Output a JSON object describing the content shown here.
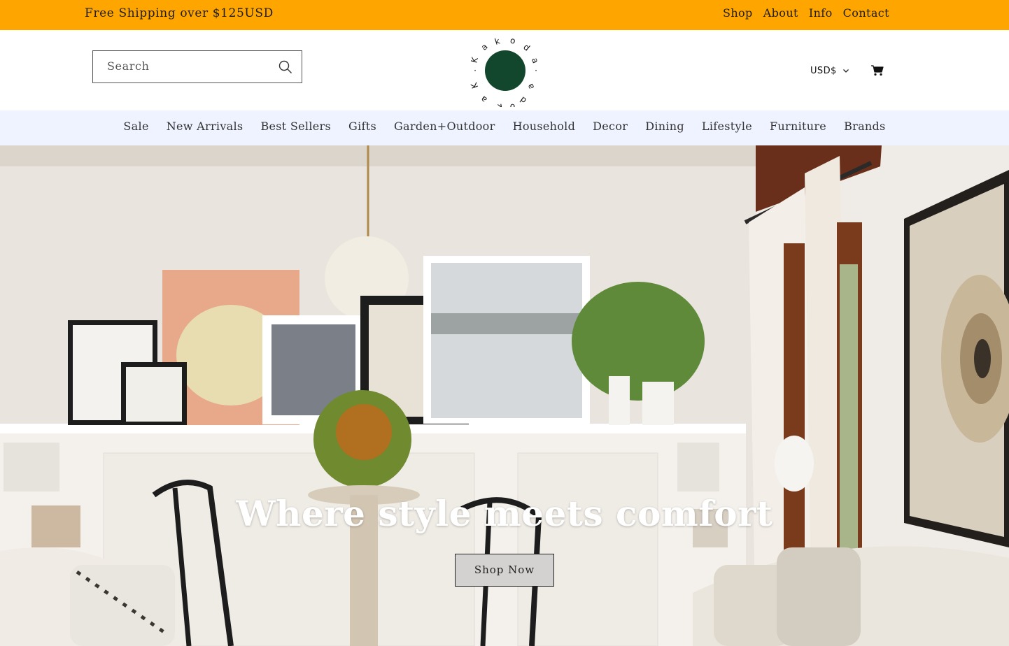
{
  "announcement": {
    "shipping_text": "Free Shipping over $125USD",
    "links": [
      "Shop",
      "About",
      "Info",
      "Contact"
    ]
  },
  "header": {
    "search_placeholder": "Search",
    "logo_text": "Kakoda",
    "currency": "USD$",
    "icons": [
      "search-icon",
      "cart-icon",
      "chevron-down-icon"
    ]
  },
  "nav": {
    "items": [
      "Sale",
      "New Arrivals",
      "Best Sellers",
      "Gifts",
      "Garden+Outdoor",
      "Household",
      "Decor",
      "Dining",
      "Lifestyle",
      "Furniture",
      "Brands"
    ]
  },
  "hero": {
    "headline": "Where style meets comfort",
    "button_label": "Shop Now"
  },
  "colors": {
    "announcement_bg": "#ffa500",
    "nav_bg": "#eef3ff",
    "logo_circle": "#12472e"
  }
}
